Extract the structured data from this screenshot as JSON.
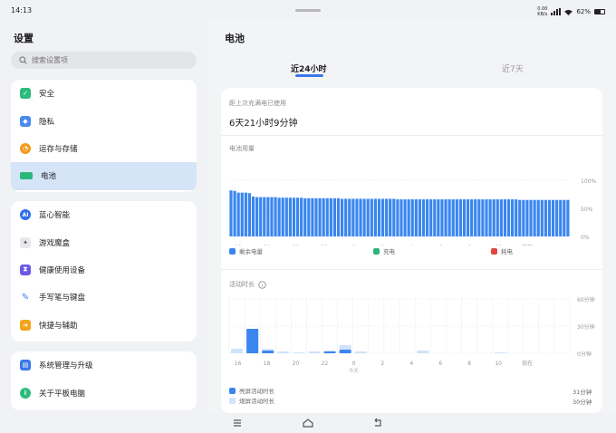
{
  "status": {
    "time": "14:13",
    "net_speed_top": "0.00",
    "net_speed_bottom": "KB/s",
    "battery_pct": "62%"
  },
  "sidebar": {
    "title": "设置",
    "search_placeholder": "搜索设置项",
    "groups": [
      [
        {
          "label": "安全",
          "icon": "shield-icon",
          "color": "#2dbb7b"
        },
        {
          "label": "隐私",
          "icon": "privacy-icon",
          "color": "#4a8af0"
        },
        {
          "label": "运存与存储",
          "icon": "storage-pie-icon",
          "color": "#f49a1b"
        },
        {
          "label": "电池",
          "icon": "battery-icon",
          "color": "#29b87b",
          "active": true
        }
      ],
      [
        {
          "label": "蓝心智能",
          "icon": "ai-icon",
          "color": "#2f6df0"
        },
        {
          "label": "游戏魔盒",
          "icon": "gamepad-icon",
          "color": "#6d6d75"
        },
        {
          "label": "健康使用设备",
          "icon": "hourglass-icon",
          "color": "#6b5ae8"
        },
        {
          "label": "手写笔与键盘",
          "icon": "pen-icon",
          "color": "#3f7ef0"
        },
        {
          "label": "快捷与辅助",
          "icon": "shortcut-icon",
          "color": "#f3a41b"
        }
      ],
      [
        {
          "label": "系统管理与升级",
          "icon": "system-icon",
          "color": "#3a78e7"
        },
        {
          "label": "关于平板电脑",
          "icon": "info-icon",
          "color": "#2dbb7b"
        }
      ]
    ]
  },
  "main": {
    "title": "电池",
    "tabs": [
      "近24小时",
      "近7天"
    ],
    "active_tab": 0,
    "since_label": "距上次充满电已使用",
    "since_value": "6天21小时9分钟",
    "usage_title": "电池用量",
    "activity_title": "活动时长"
  },
  "chart_data": [
    {
      "type": "bar",
      "title": "电池用量",
      "y_ticks": [
        "100%",
        "50%",
        "0%"
      ],
      "ylim": [
        0,
        100
      ],
      "x_ticks": [
        "16",
        "18",
        "20",
        "22",
        "0",
        "2",
        "4",
        "6",
        "8",
        "10",
        "现在"
      ],
      "x_sublabel": "今天",
      "series": [
        {
          "name": "剩余电量",
          "color": "#3a86f0",
          "values": [
            82,
            81,
            78,
            78,
            78,
            77,
            71,
            70,
            70,
            70,
            70,
            70,
            70,
            69,
            69,
            69,
            69,
            69,
            69,
            69,
            68,
            68,
            68,
            68,
            68,
            68,
            68,
            68,
            68,
            68,
            67,
            67,
            67,
            67,
            67,
            67,
            67,
            67,
            67,
            67,
            67,
            67,
            67,
            67,
            67,
            66,
            66,
            66,
            66,
            66,
            66,
            66,
            66,
            66,
            66,
            66,
            66,
            66,
            66,
            66,
            66,
            66,
            66,
            66,
            66,
            66,
            66,
            66,
            66,
            66,
            66,
            66,
            66,
            66,
            66,
            66,
            66,
            66,
            65,
            65,
            65,
            65,
            65,
            65,
            65,
            65,
            65,
            65,
            65,
            65,
            65,
            65
          ]
        }
      ],
      "legend": [
        {
          "label": "剩余电量",
          "color": "#3a86f0"
        },
        {
          "label": "充电",
          "color": "#2db47b"
        },
        {
          "label": "耗电",
          "color": "#e2463e"
        }
      ]
    },
    {
      "type": "bar",
      "title": "活动时长",
      "y_ticks": [
        "60分钟",
        "30分钟",
        "0分钟"
      ],
      "ylim": [
        0,
        60
      ],
      "x_ticks": [
        "16",
        "18",
        "20",
        "22",
        "0",
        "2",
        "4",
        "6",
        "8",
        "10",
        "现在"
      ],
      "x_sublabel": "今天",
      "series": [
        {
          "name": "亮屏活动时长",
          "color": "#3a86f0",
          "values": [
            0,
            27,
            3,
            0,
            0,
            0,
            2,
            4,
            0,
            0,
            0,
            0,
            0,
            0,
            0,
            0,
            0,
            0,
            0,
            0,
            0,
            0
          ]
        },
        {
          "name": "熄屏活动时长",
          "color": "#cfe3fb",
          "values": [
            5,
            0,
            2,
            2,
            1,
            2,
            1,
            5,
            2,
            0,
            0,
            0,
            3,
            0,
            0,
            0,
            0,
            1,
            0,
            0,
            0,
            0
          ]
        }
      ],
      "totals": [
        "31分钟",
        "30分钟"
      ]
    }
  ]
}
